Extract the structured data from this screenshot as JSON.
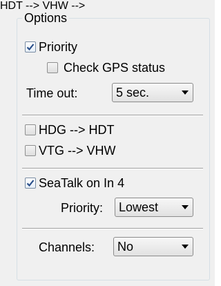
{
  "group": {
    "title": "Options"
  },
  "priority": {
    "label": "Priority",
    "checked": true
  },
  "check_gps": {
    "label": "Check GPS status",
    "checked": false
  },
  "timeout": {
    "label": "Time out:",
    "value": "5 sec."
  },
  "hdg_hdt": {
    "label": "HDG --> HDT",
    "checked": false
  },
  "vtg_vhw": {
    "label": "VTG --> VHW",
    "checked": false
  },
  "seatalk": {
    "label": "SeaTalk on In 4",
    "checked": true
  },
  "seatalk_priority": {
    "label": "Priority:",
    "value": "Lowest"
  },
  "channels": {
    "label": "Channels:",
    "value": "No"
  },
  "icons": {
    "checkmark": "checkmark-icon",
    "dropdown": "dropdown-arrow-icon"
  },
  "colors": {
    "checkmark": "#2a4f8a",
    "separator": "#a0a0a0",
    "groupbox_border": "#d5dfe5"
  }
}
